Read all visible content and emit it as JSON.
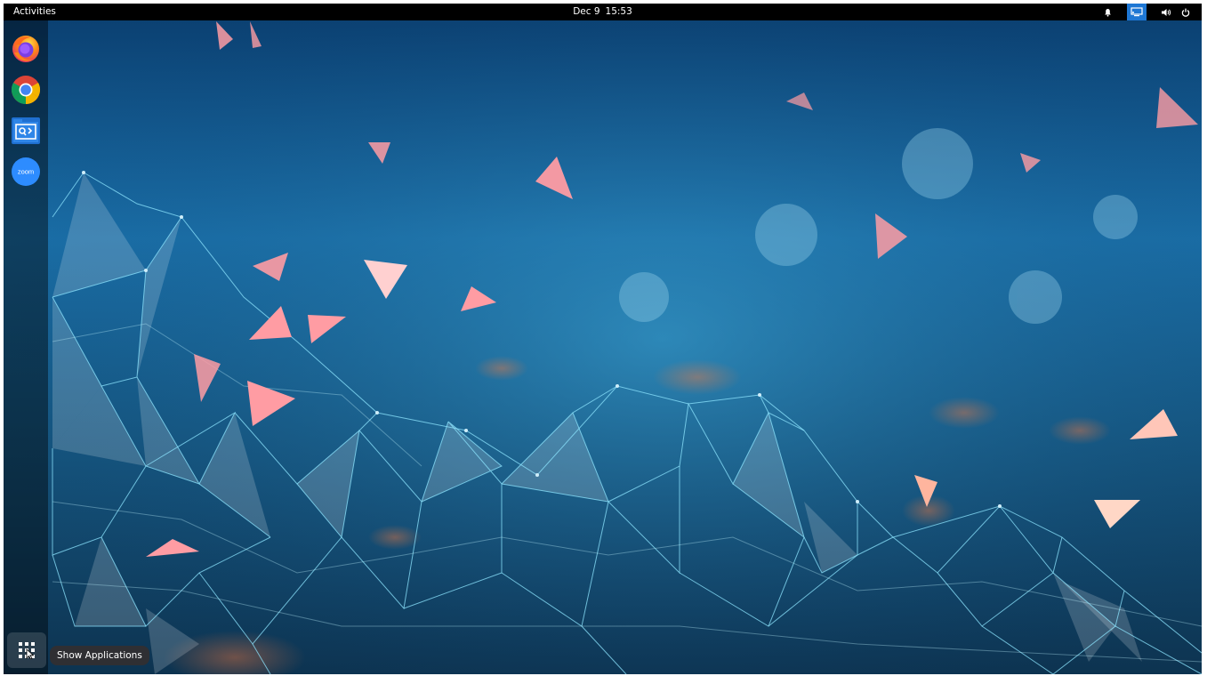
{
  "topbar": {
    "activities_label": "Activities",
    "date": "Dec 9",
    "time": "15:53",
    "tray_icons": [
      "notification-bell",
      "screen-share",
      "volume",
      "power"
    ],
    "active_tray_color": "#1e77d4"
  },
  "dock": {
    "apps": [
      {
        "name": "Firefox",
        "icon": "firefox-icon"
      },
      {
        "name": "Google Chrome",
        "icon": "chrome-icon"
      },
      {
        "name": "Remmina",
        "icon": "remmina-icon"
      },
      {
        "name": "Zoom",
        "icon": "zoom-icon",
        "icon_text": "zoom"
      }
    ],
    "show_apps_icon": "grid-icon",
    "tooltip": "Show Applications"
  },
  "wallpaper": {
    "description_colors": {
      "base": "#0b3a63",
      "mesh": "#4fd1f0",
      "accent": "#ff8c8c"
    }
  }
}
